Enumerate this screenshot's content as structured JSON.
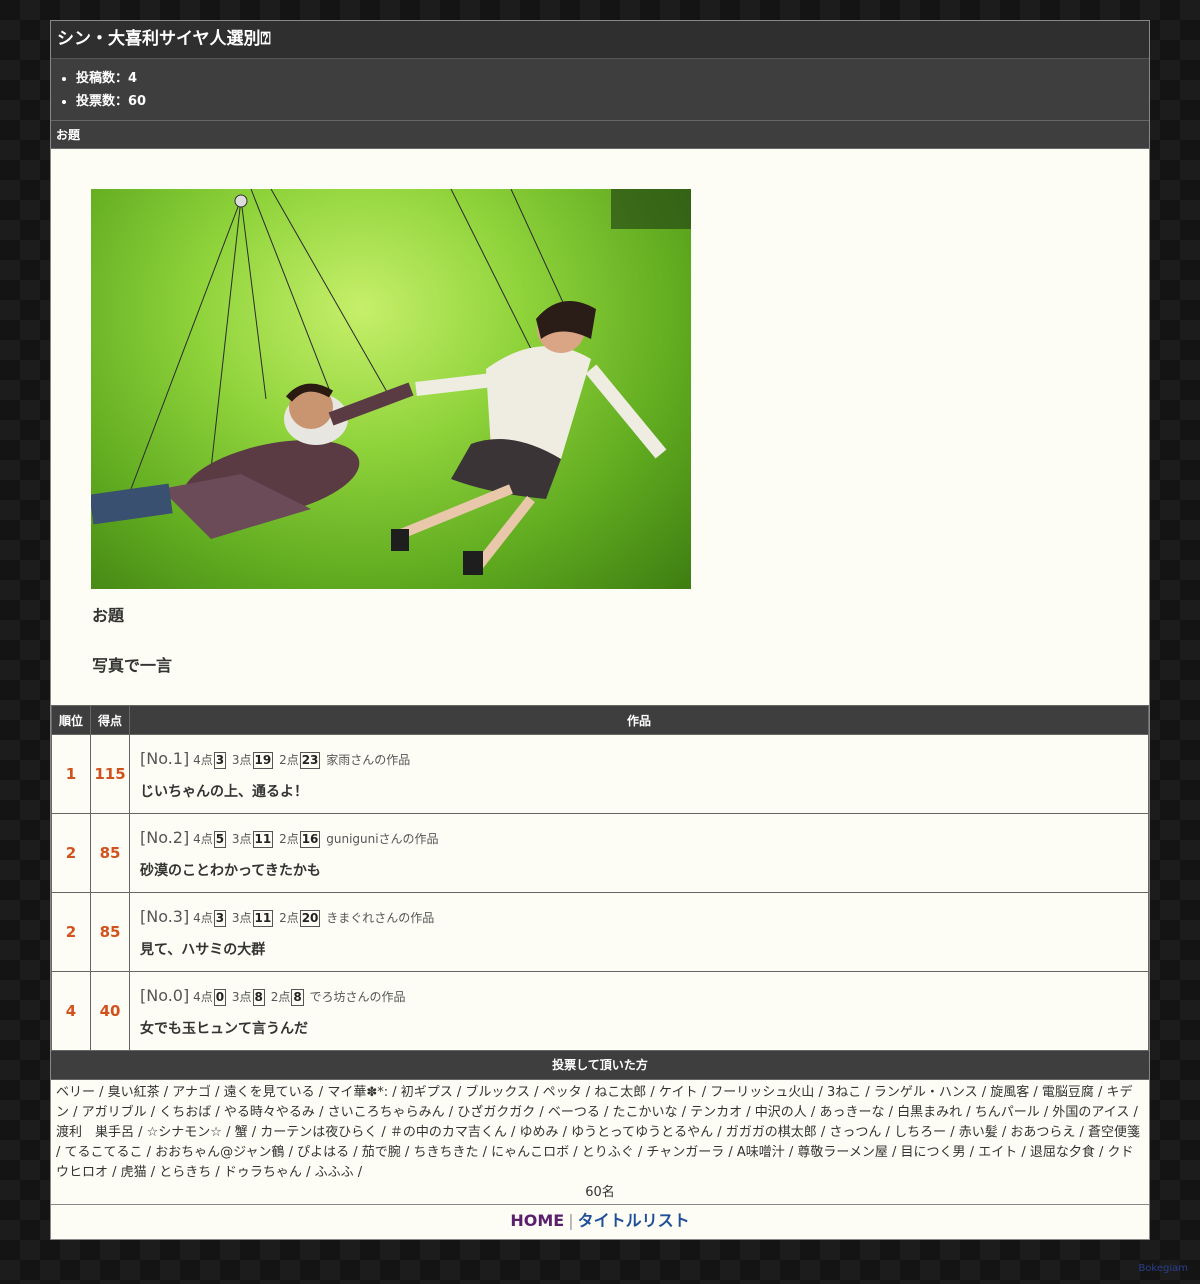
{
  "title": "シン・大喜利サイヤ人選別⍰",
  "stats": {
    "posts_label": "投稿数：4",
    "votes_label": "投票数：60"
  },
  "theme": {
    "section_label": "お題",
    "label": "お題",
    "text": "写真で一言",
    "photo_icon": "photo-two-people-flying-on-wires"
  },
  "table": {
    "headers": {
      "rank": "順位",
      "score": "得点",
      "work": "作品"
    },
    "rows": [
      {
        "rank": "1",
        "score": "115",
        "no": "[No.1]",
        "p4": "4点",
        "v4": "3",
        "p3": "3点",
        "v3": "19",
        "p2": "2点",
        "v2": "23",
        "author": "家雨さんの作品",
        "text": "じいちゃんの上、通るよ！"
      },
      {
        "rank": "2",
        "score": "85",
        "no": "[No.2]",
        "p4": "4点",
        "v4": "5",
        "p3": "3点",
        "v3": "11",
        "p2": "2点",
        "v2": "16",
        "author": "guniguniさんの作品",
        "text": "砂漠のことわかってきたかも"
      },
      {
        "rank": "2",
        "score": "85",
        "no": "[No.3]",
        "p4": "4点",
        "v4": "3",
        "p3": "3点",
        "v3": "11",
        "p2": "2点",
        "v2": "20",
        "author": "きまぐれさんの作品",
        "text": "見て、ハサミの大群"
      },
      {
        "rank": "4",
        "score": "40",
        "no": "[No.0]",
        "p4": "4点",
        "v4": "0",
        "p3": "3点",
        "v3": "8",
        "p2": "2点",
        "v2": "8",
        "author": "でろ坊さんの作品",
        "text": "女でも玉ヒュンて言うんだ"
      }
    ]
  },
  "voters": {
    "heading": "投票して頂いた方",
    "list": "ベリー / 臭い紅茶 / アナゴ / 遠くを見ている / マイ華✽*: / 初ギプス / ブルックス / ペッタ / ねこ太郎 / ケイト / フーリッシュ火山 / 3ねこ / ランゲル・ハンス / 旋風客 / 電脳豆腐 / キデン / アガリブル / くちおば / やる時々やるみ / さいころちゃらみん / ひざガクガク / ベーつる / たこかいな / テンカオ / 中沢の人 / あっきーな / 白黒まみれ / ちんパール / 外国のアイス / 渡利　巣手呂 / ☆シナモン☆ / 蟹 / カーテンは夜ひらく / ＃の中のカマ吉くん / ゆめみ / ゆうとってゆうとるやん / ガガガの棋太郎 / さっつん / しちろー / 赤い髪 / おあつらえ / 蒼空便箋 / てるこてるこ / おおちゃん@ジャン鶴 / ぴよはる / 茄で腕 / ちきちきた / にゃんこロボ / とりふぐ / チャンガーラ / A味噌汁 / 尊敬ラーメン屋 / 目につく男 / エイト / 退屈な夕食 / クドウヒロオ / 虎猫 / とらきち / ドゥラちゃん / ふふふ /",
    "count": "60名"
  },
  "footer": {
    "home": "HOME",
    "separator": "|",
    "title_list": "タイトルリスト"
  },
  "credit": "Bokegiam"
}
